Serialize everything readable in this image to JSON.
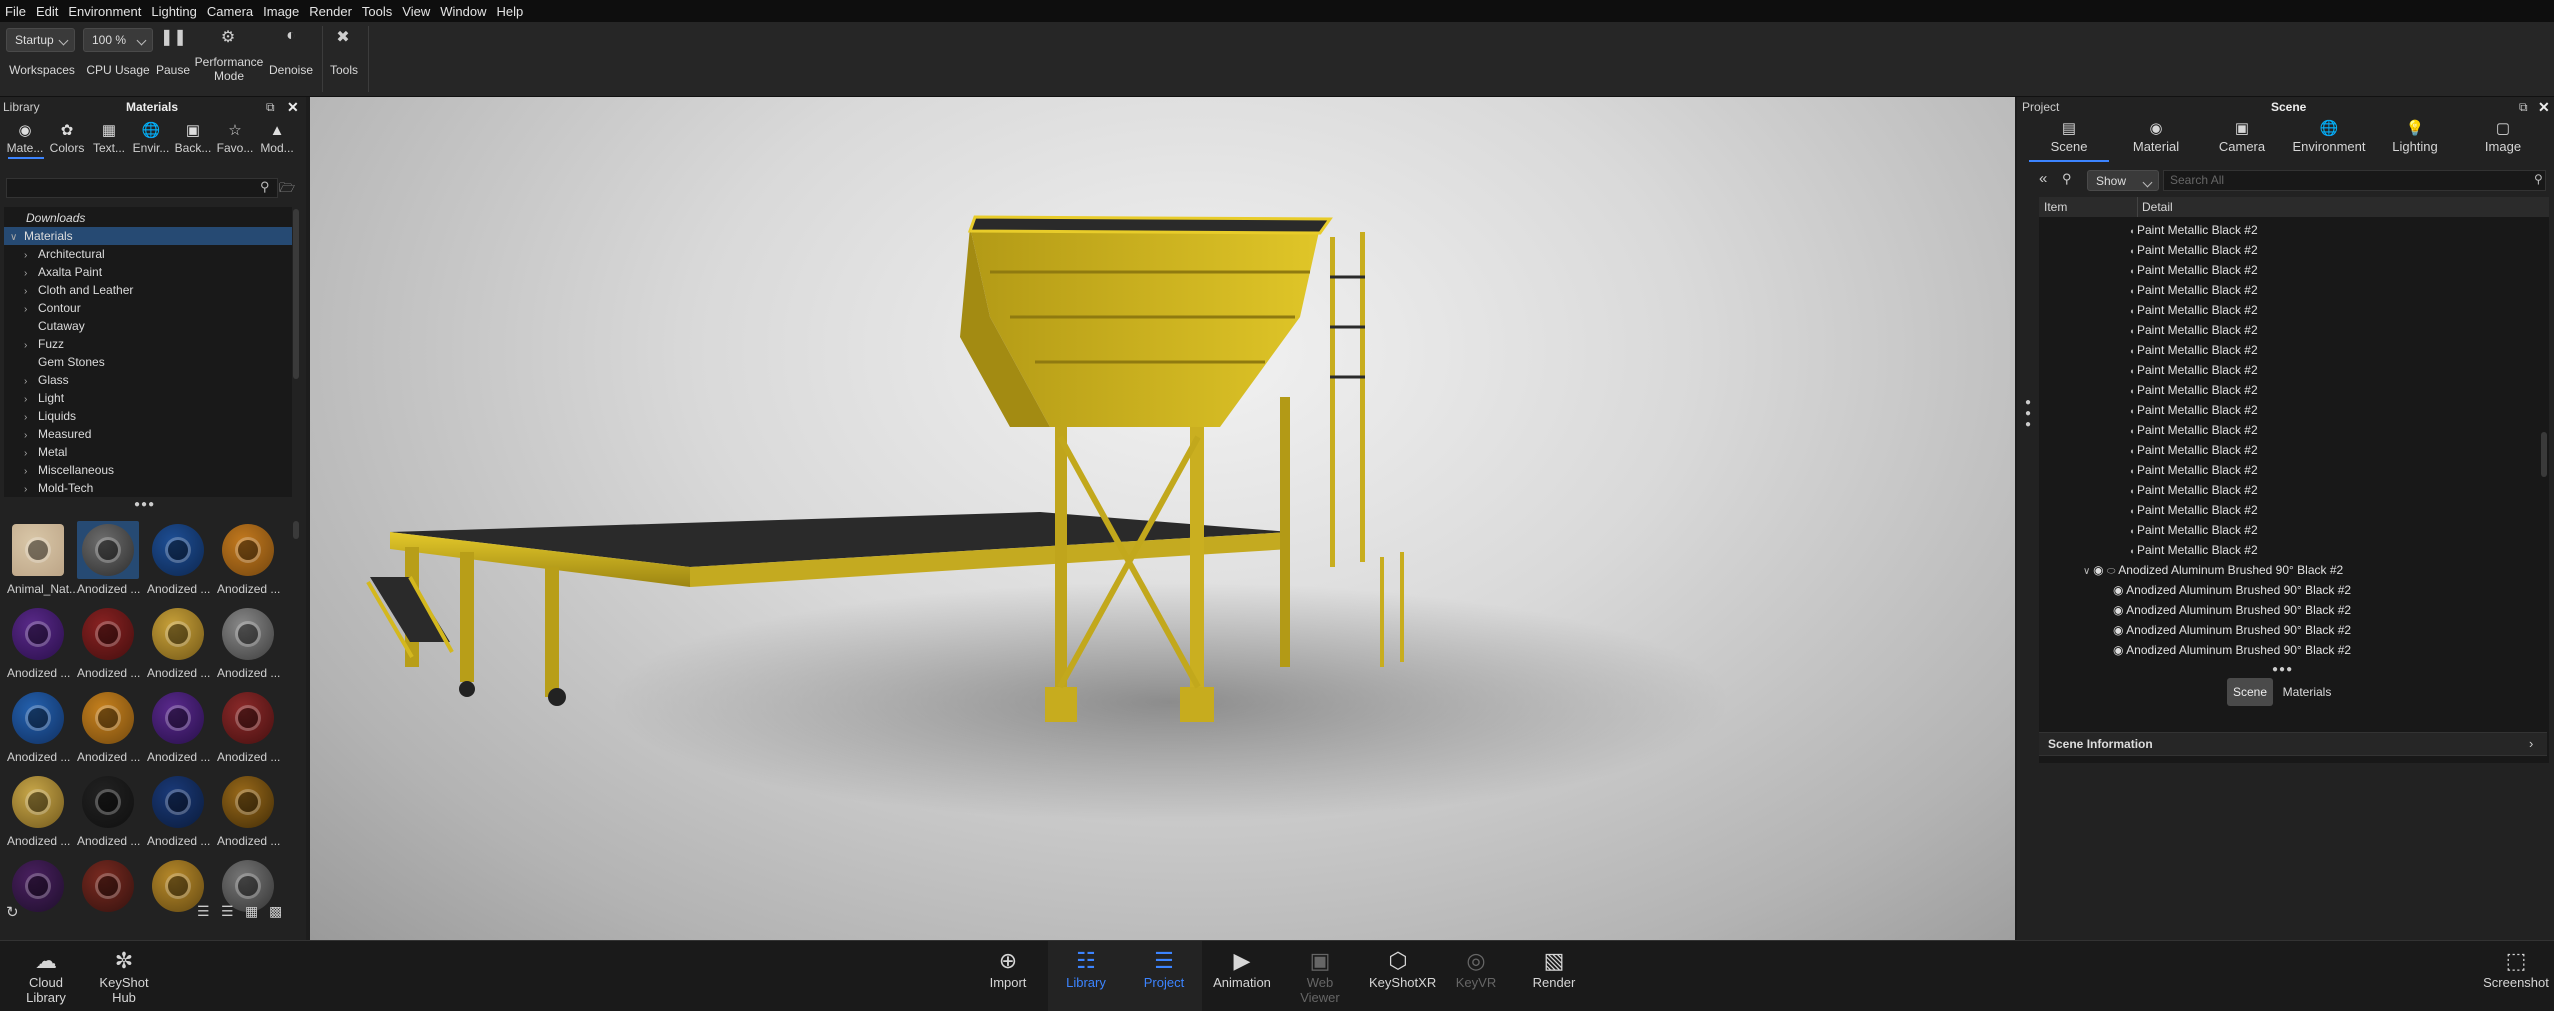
{
  "menu": [
    "File",
    "Edit",
    "Environment",
    "Lighting",
    "Camera",
    "Image",
    "Render",
    "Tools",
    "View",
    "Window",
    "Help"
  ],
  "toolbar": {
    "workspace_value": "Startup",
    "zoom_value": "100 %",
    "workspaces_label": "Workspaces",
    "cpu_label": "CPU Usage",
    "pause_label": "Pause",
    "performance_label": "Performance",
    "performance_label2": "Mode",
    "denoise_label": "Denoise",
    "tools_label": "Tools"
  },
  "library": {
    "title": "Library",
    "panel_title": "Materials",
    "tabs": [
      {
        "label": "Mate...",
        "icon": "material-icon"
      },
      {
        "label": "Colors",
        "icon": "palette-icon"
      },
      {
        "label": "Text...",
        "icon": "texture-icon"
      },
      {
        "label": "Envir...",
        "icon": "globe-icon"
      },
      {
        "label": "Back...",
        "icon": "image-icon"
      },
      {
        "label": "Favo...",
        "icon": "star-icon"
      },
      {
        "label": "Mod...",
        "icon": "models-icon"
      }
    ],
    "search_placeholder": "",
    "downloads": "Downloads",
    "root": "Materials",
    "tree": [
      {
        "label": "Architectural",
        "arrow": true
      },
      {
        "label": "Axalta Paint",
        "arrow": true
      },
      {
        "label": "Cloth and Leather",
        "arrow": true
      },
      {
        "label": "Contour",
        "arrow": true
      },
      {
        "label": "Cutaway",
        "arrow": false
      },
      {
        "label": "Fuzz",
        "arrow": true
      },
      {
        "label": "Gem Stones",
        "arrow": false
      },
      {
        "label": "Glass",
        "arrow": true
      },
      {
        "label": "Light",
        "arrow": true
      },
      {
        "label": "Liquids",
        "arrow": true
      },
      {
        "label": "Measured",
        "arrow": true
      },
      {
        "label": "Metal",
        "arrow": true
      },
      {
        "label": "Miscellaneous",
        "arrow": true
      },
      {
        "label": "Mold-Tech",
        "arrow": true
      }
    ],
    "thumbs": [
      {
        "label": "Animal_Nat...",
        "color": "#d9c7a8",
        "inner": "#bfa88a"
      },
      {
        "label": "Anodized ...",
        "color": "#6e6e6e",
        "inner": "#333"
      },
      {
        "label": "Anodized ...",
        "color": "#1e4f96",
        "inner": "#0e2a55"
      },
      {
        "label": "Anodized ...",
        "color": "#c47a1e",
        "inner": "#7a4a10"
      },
      {
        "label": "Anodized ...",
        "color": "#5a2a8a",
        "inner": "#2e1150"
      },
      {
        "label": "Anodized ...",
        "color": "#8a2222",
        "inner": "#4a1010"
      },
      {
        "label": "Anodized ...",
        "color": "#c9a23a",
        "inner": "#7a5e1a"
      },
      {
        "label": "Anodized ...",
        "color": "#8a8a8a",
        "inner": "#444"
      },
      {
        "label": "Anodized ...",
        "color": "#2462b0",
        "inner": "#123468"
      },
      {
        "label": "Anodized ...",
        "color": "#c8821e",
        "inner": "#7a4e10"
      },
      {
        "label": "Anodized ...",
        "color": "#5b2a8e",
        "inner": "#2c1250"
      },
      {
        "label": "Anodized ...",
        "color": "#8c2a2a",
        "inner": "#4c1212"
      },
      {
        "label": "Anodized ...",
        "color": "#c9a84a",
        "inner": "#7a6020"
      },
      {
        "label": "Anodized ...",
        "color": "#222",
        "inner": "#111"
      },
      {
        "label": "Anodized ...",
        "color": "#1a3a7a",
        "inner": "#0c1e40"
      },
      {
        "label": "Anodized ...",
        "color": "#9a6a1a",
        "inner": "#4a3208"
      },
      {
        "label": "",
        "color": "#4a2060",
        "inner": "#221030"
      },
      {
        "label": "",
        "color": "#7a2a20",
        "inner": "#3a1410"
      },
      {
        "label": "",
        "color": "#b88a2a",
        "inner": "#6a4e14"
      },
      {
        "label": "",
        "color": "#777",
        "inner": "#3a3a3a"
      }
    ]
  },
  "scene": {
    "project_label": "Project",
    "panel_title": "Scene",
    "tabs": [
      {
        "label": "Scene",
        "icon": "scene-icon"
      },
      {
        "label": "Material",
        "icon": "material-icon"
      },
      {
        "label": "Camera",
        "icon": "camera-icon"
      },
      {
        "label": "Environment",
        "icon": "globe-icon"
      },
      {
        "label": "Lighting",
        "icon": "bulb-icon"
      },
      {
        "label": "Image",
        "icon": "image-icon"
      }
    ],
    "show_value": "Show",
    "search_placeholder": "Search All",
    "col_item": "Item",
    "col_detail": "Detail",
    "rows": [
      "Paint Metallic Black #2",
      "Paint Metallic Black #2",
      "Paint Metallic Black #2",
      "Paint Metallic Black #2",
      "Paint Metallic Black #2",
      "Paint Metallic Black #2",
      "Paint Metallic Black #2",
      "Paint Metallic Black #2",
      "Paint Metallic Black #2",
      "Paint Metallic Black #2",
      "Paint Metallic Black #2",
      "Paint Metallic Black #2",
      "Paint Metallic Black #2",
      "Paint Metallic Black #2",
      "Paint Metallic Black #2",
      "Paint Metallic Black #2",
      "Paint Metallic Black #2"
    ],
    "group_row": "Anodized Aluminum Brushed 90° Black #2",
    "sub_rows": [
      "Anodized Aluminum Brushed 90° Black #2",
      "Anodized Aluminum Brushed 90° Black #2",
      "Anodized Aluminum Brushed 90° Black #2",
      "Anodized Aluminum Brushed 90° Black #2"
    ],
    "toggle_scene": "Scene",
    "toggle_materials": "Materials",
    "info_label": "Scene Information"
  },
  "bottom": {
    "cloud": "Cloud",
    "cloud2": "Library",
    "hub": "KeyShot",
    "hub2": "Hub",
    "buttons": [
      {
        "label": "Import",
        "state": "normal"
      },
      {
        "label": "Library",
        "state": "active"
      },
      {
        "label": "Project",
        "state": "active"
      },
      {
        "label": "Animation",
        "state": "normal"
      },
      {
        "label": "Web Viewer",
        "state": "dim"
      },
      {
        "label": "KeyShotXR",
        "state": "normal"
      },
      {
        "label": "KeyVR",
        "state": "dim"
      },
      {
        "label": "Render",
        "state": "normal"
      }
    ],
    "screenshot": "Screenshot"
  },
  "colors": {
    "accent": "#3c84ff",
    "selection": "#264a73",
    "model_yellow": "#d4b81e"
  }
}
